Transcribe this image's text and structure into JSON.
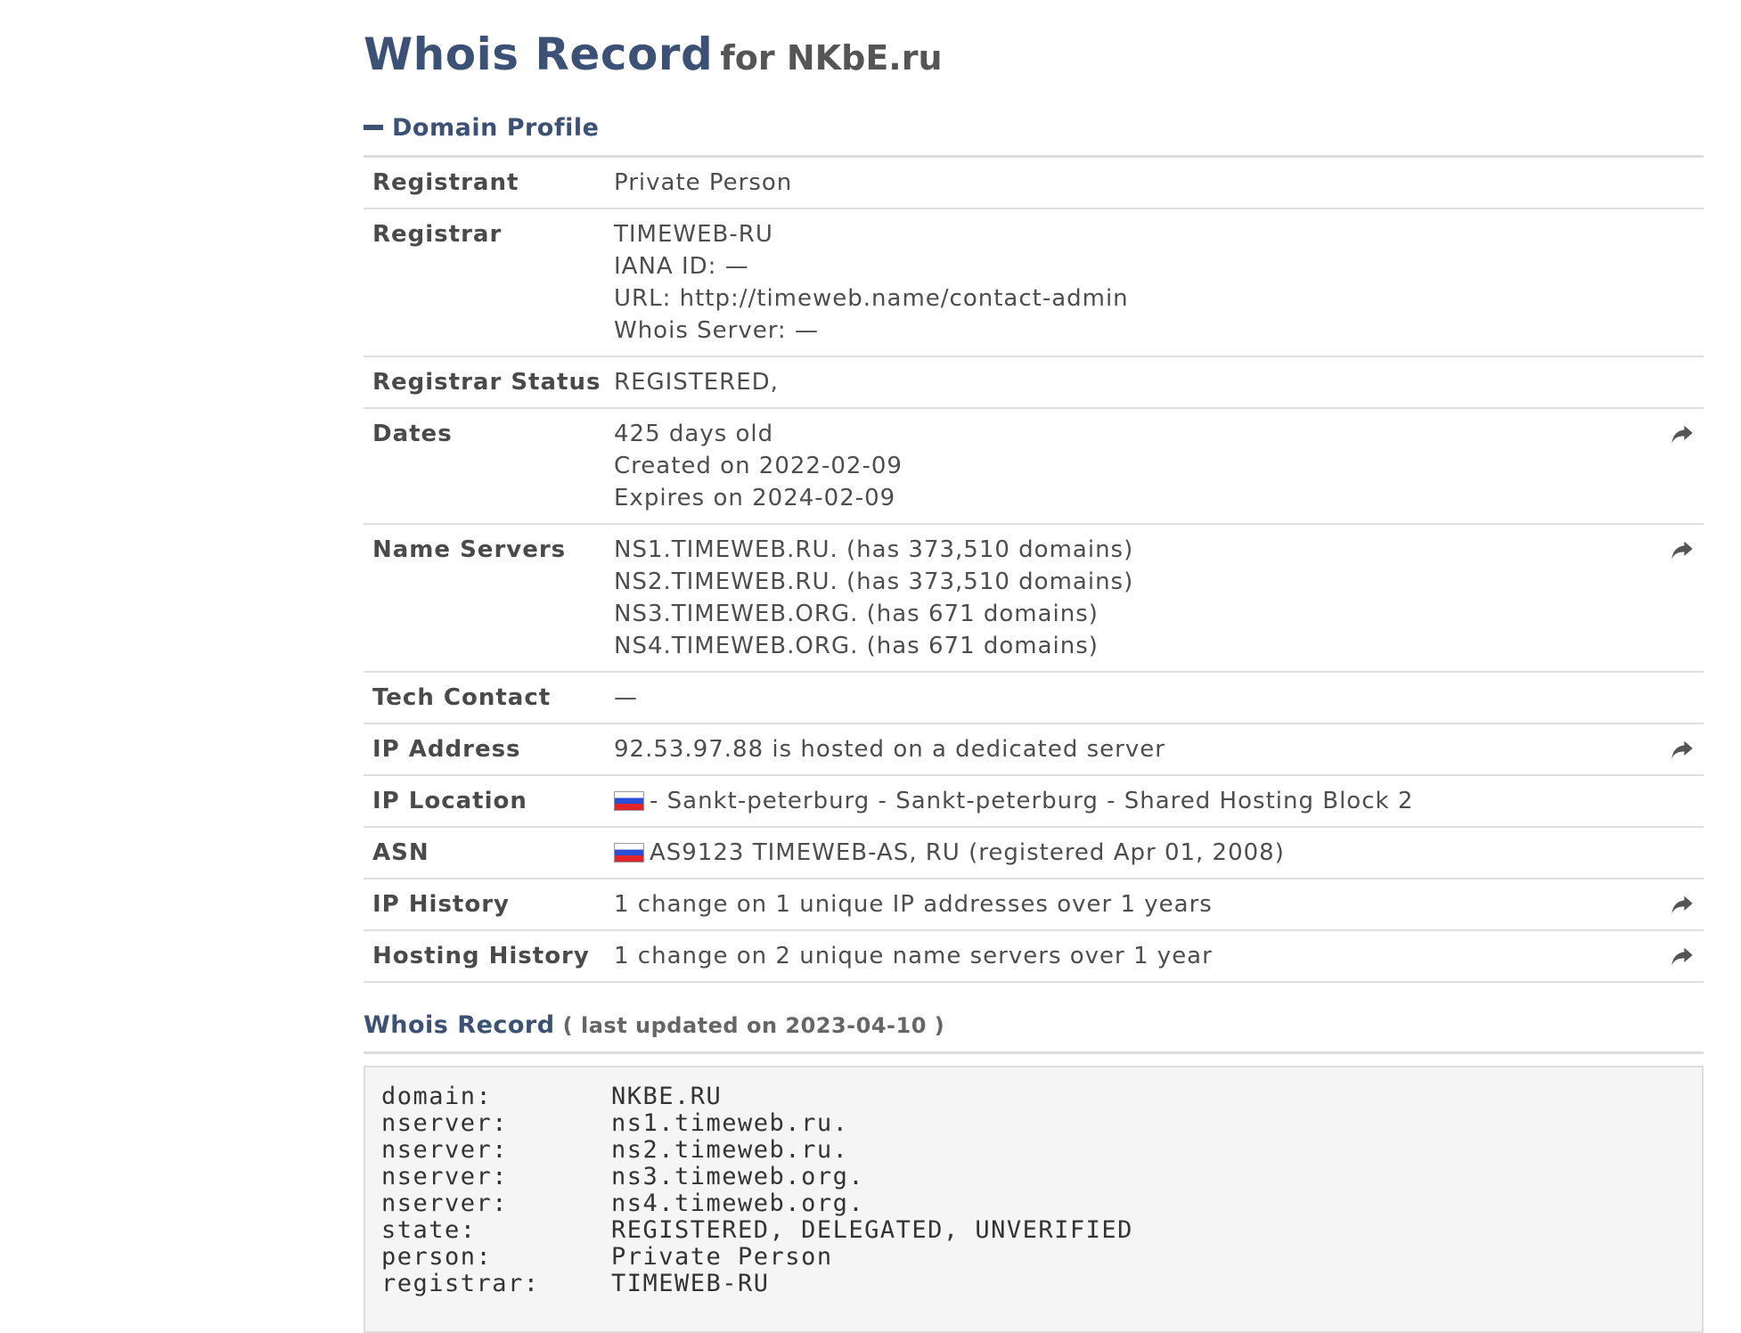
{
  "header": {
    "title": "Whois Record",
    "subtitle": "for NKbE.ru"
  },
  "domain_profile": {
    "toggle_label": "Domain Profile",
    "rows": [
      {
        "label": "Registrant",
        "lines": [
          "Private Person"
        ],
        "share": false
      },
      {
        "label": "Registrar",
        "lines": [
          "TIMEWEB-RU",
          "IANA ID: —",
          "URL: http://timeweb.name/contact-admin",
          "Whois Server: —"
        ],
        "share": false
      },
      {
        "label": "Registrar Status",
        "lines": [
          "REGISTERED,"
        ],
        "share": false
      },
      {
        "label": "Dates",
        "lines": [
          "425 days old",
          "Created on 2022-02-09",
          "Expires on 2024-02-09"
        ],
        "share": true
      },
      {
        "label": "Name Servers",
        "lines": [
          "NS1.TIMEWEB.RU. (has 373,510 domains)",
          "NS2.TIMEWEB.RU. (has 373,510 domains)",
          "NS3.TIMEWEB.ORG. (has 671 domains)",
          "NS4.TIMEWEB.ORG. (has 671 domains)"
        ],
        "share": true
      },
      {
        "label": "Tech Contact",
        "lines": [
          "—"
        ],
        "share": false
      },
      {
        "label": "IP Address",
        "lines": [
          "92.53.97.88 is hosted on a dedicated server"
        ],
        "share": true
      },
      {
        "label": "IP Location",
        "lines": [
          "- Sankt-peterburg - Sankt-peterburg - Shared Hosting Block 2"
        ],
        "share": false,
        "flag": "russia-flag"
      },
      {
        "label": "ASN",
        "lines": [
          "AS9123 TIMEWEB-AS, RU (registered Apr 01, 2008)"
        ],
        "share": false,
        "flag": "russia-flag"
      },
      {
        "label": "IP History",
        "lines": [
          "1 change on 1 unique IP addresses over 1 years"
        ],
        "share": true
      },
      {
        "label": "Hosting History",
        "lines": [
          "1 change on 2 unique name servers over 1 year"
        ],
        "share": true
      }
    ]
  },
  "whois_record": {
    "link_label": "Whois Record",
    "updated_text": "( last updated on 2023-04-10 )",
    "raw": [
      {
        "key": "domain:",
        "value": "NKBE.RU"
      },
      {
        "key": "nserver:",
        "value": "ns1.timeweb.ru."
      },
      {
        "key": "nserver:",
        "value": "ns2.timeweb.ru."
      },
      {
        "key": "nserver:",
        "value": "ns3.timeweb.org."
      },
      {
        "key": "nserver:",
        "value": "ns4.timeweb.org."
      },
      {
        "key": "state:",
        "value": "REGISTERED, DELEGATED, UNVERIFIED"
      },
      {
        "key": "person:",
        "value": "Private Person"
      },
      {
        "key": "registrar:",
        "value": "TIMEWEB-RU"
      }
    ]
  },
  "colors": {
    "accent": "#3b5176",
    "text": "#4a4a4a",
    "divider": "#dedede",
    "raw_background": "#f5f5f5"
  }
}
